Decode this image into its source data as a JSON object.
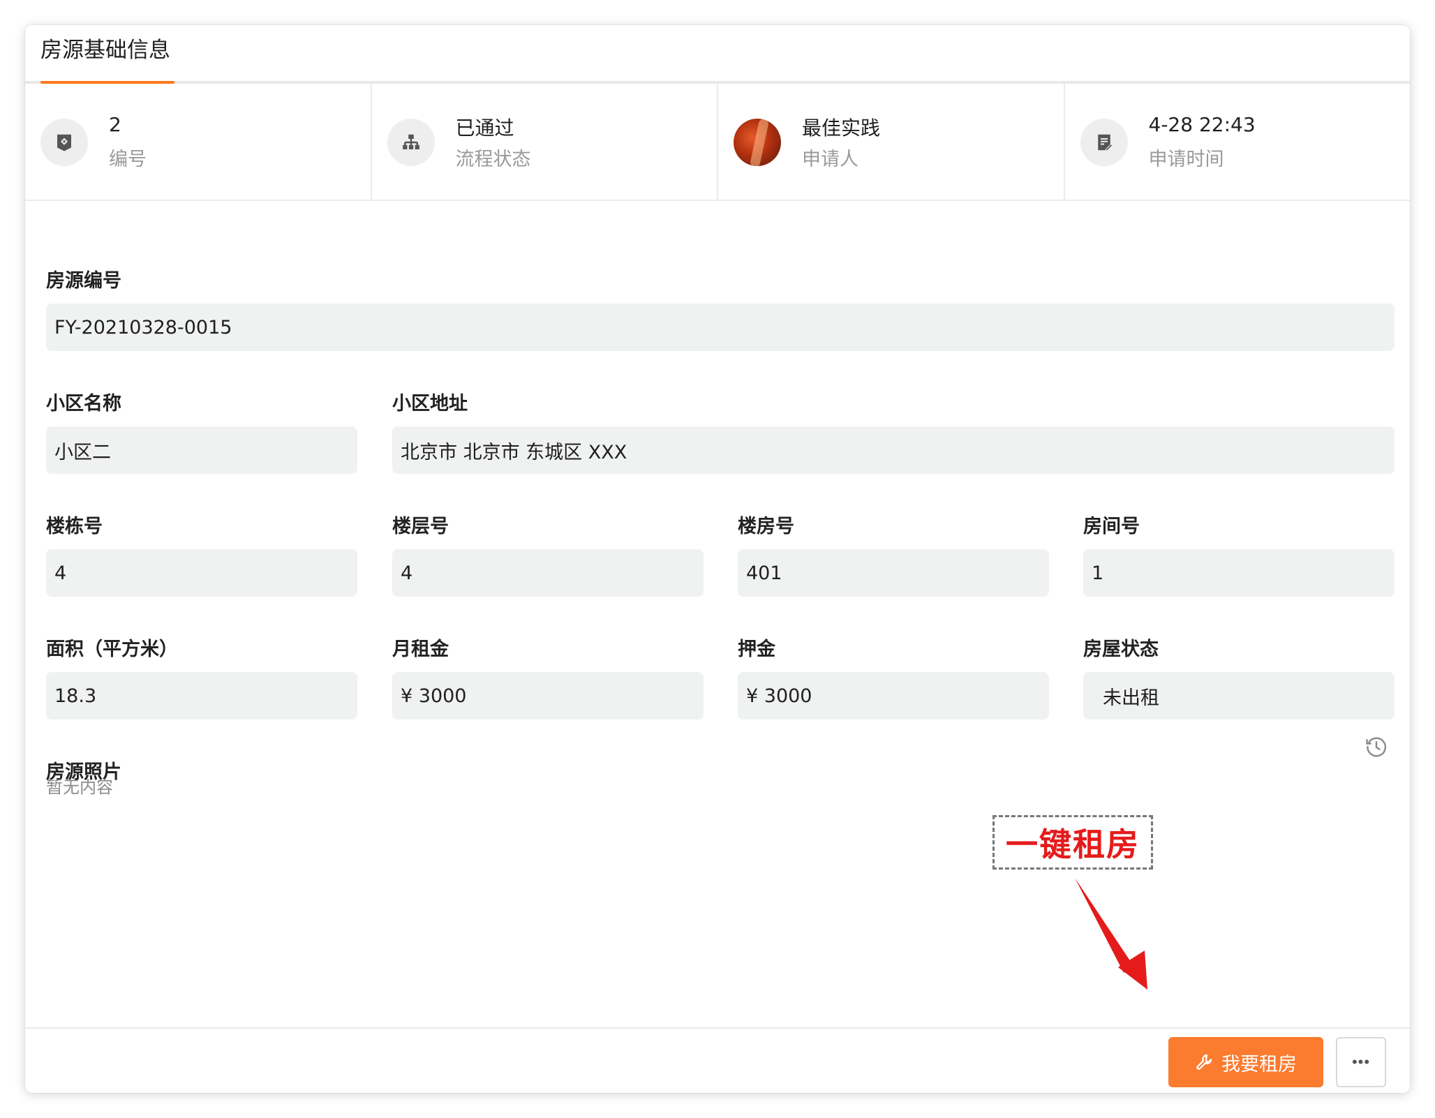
{
  "tab": {
    "label": "房源基础信息"
  },
  "stats": [
    {
      "value": "2",
      "label": "编号",
      "icon": "tag-icon"
    },
    {
      "value": "已通过",
      "label": "流程状态",
      "icon": "flow-tree-icon"
    },
    {
      "value": "最佳实践",
      "label": "申请人",
      "icon": "avatar"
    },
    {
      "value": "4-28 22:43",
      "label": "申请时间",
      "icon": "document-edit-icon"
    }
  ],
  "fields": {
    "listing_no": {
      "label": "房源编号",
      "value": "FY-20210328-0015"
    },
    "community_name": {
      "label": "小区名称",
      "value": "小区二"
    },
    "community_address": {
      "label": "小区地址",
      "value": "北京市 北京市 东城区 XXX"
    },
    "building_no": {
      "label": "楼栋号",
      "value": "4"
    },
    "floor_no": {
      "label": "楼层号",
      "value": "4"
    },
    "unit_no": {
      "label": "楼房号",
      "value": "401"
    },
    "room_no": {
      "label": "房间号",
      "value": "1"
    },
    "area": {
      "label": "面积（平方米）",
      "value": "18.3"
    },
    "monthly_rent": {
      "label": "月租金",
      "value": "¥ 3000"
    },
    "deposit": {
      "label": "押金",
      "value": "¥ 3000"
    },
    "house_status": {
      "label": "房屋状态",
      "value": "未出租"
    },
    "photos": {
      "label": "房源照片",
      "empty": "暂无内容"
    }
  },
  "annotation": {
    "text": "一键租房",
    "color": "#e51b1b"
  },
  "footer": {
    "primary_label": "我要租房",
    "more_label": "•••"
  },
  "colors": {
    "accent": "#fb7b2f",
    "field_bg": "#f0f1f1"
  }
}
